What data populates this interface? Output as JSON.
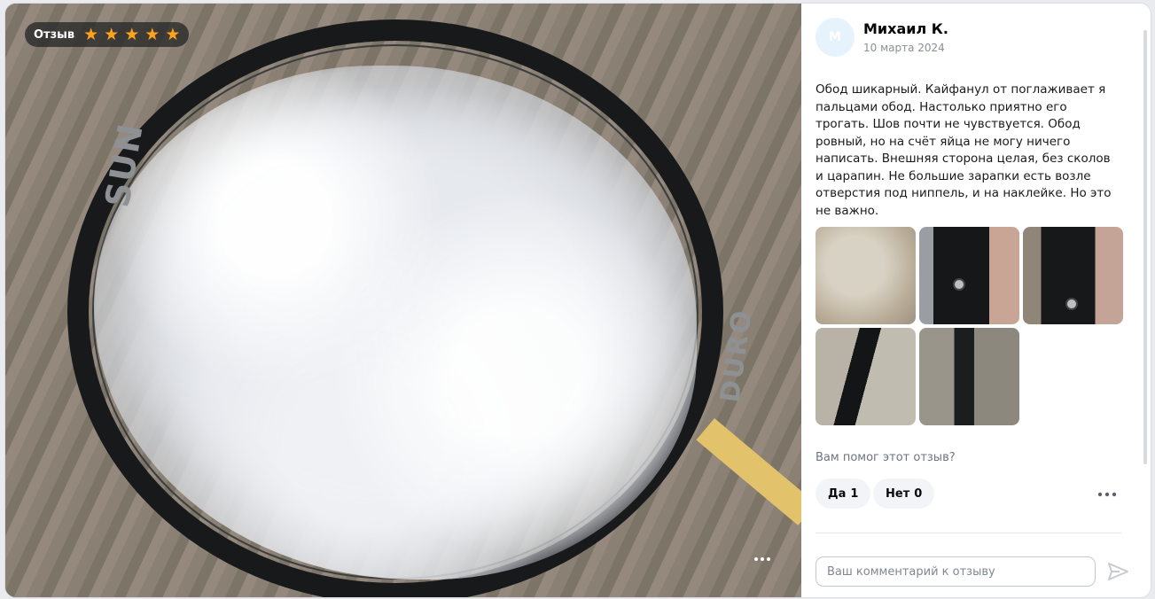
{
  "photo": {
    "badge_label": "Отзыв",
    "rating": 5,
    "stars": [
      "★",
      "★",
      "★",
      "★",
      "★"
    ],
    "rim_brand": "SUN",
    "rim_model": "DURO",
    "more_icon": "ellipsis-icon"
  },
  "review": {
    "avatar_initial": "М",
    "author": "Михаил К.",
    "date": "10 марта 2024",
    "text": "Обод шикарный. Кайфанул от поглаживает я пальцами обод. Настолько приятно его трогать. Шов почти не чувствуется. Обод ровный, но на счёт яйца не могу ничего написать. Внешняя сторона целая, без сколов и царапин. Не большие зарапки есть возле отверстия под ниппель, и на наклейке. Но это не важно."
  },
  "feedback": {
    "question": "Вам помог этот отзыв?",
    "yes_label": "Да",
    "yes_count": "1",
    "no_label": "Нет",
    "no_count": "0"
  },
  "comment": {
    "placeholder": "Ваш комментарий к отзыву"
  },
  "colors": {
    "star": "#ffa31a",
    "avatar_bg": "#e6f2fc",
    "button_bg": "#f2f4f7"
  }
}
